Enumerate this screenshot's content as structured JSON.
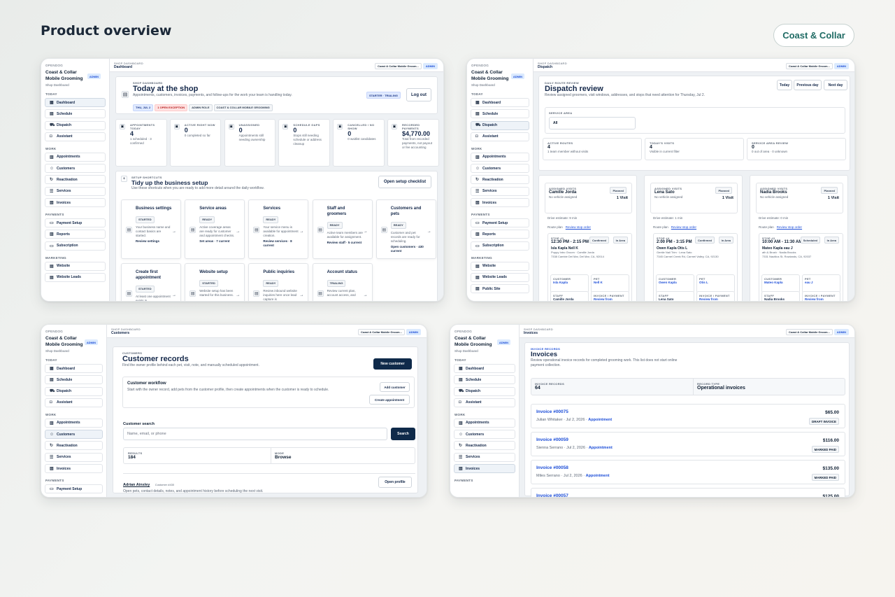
{
  "page": {
    "title": "Product overview",
    "brand": "Coast & Collar"
  },
  "sidebar": {
    "org": "OPENDOG",
    "shop": "Coast & Collar Mobile Grooming",
    "admin": "ADMIN",
    "sub": "Shop Dashboard",
    "sections": {
      "today": "TODAY",
      "work": "WORK",
      "payments": "PAYMENTS",
      "marketing": "MARKETING"
    },
    "items": {
      "dashboard": "Dashboard",
      "schedule": "Schedule",
      "dispatch": "Dispatch",
      "assistant": "Assistant",
      "appointments": "Appointments",
      "customers": "Customers",
      "reactivation": "Reactivation",
      "services": "Services",
      "invoices": "Invoices",
      "payment_setup": "Payment Setup",
      "reports": "Reports",
      "subscription": "Subscription",
      "website": "Website",
      "website_leads": "Website Leads",
      "public_site": "Public Site"
    }
  },
  "topbar": {
    "kicker": "SHOP DASHBOARD",
    "shop_chip": "Coast & Collar Mobile Groom...",
    "admin": "ADMIN"
  },
  "dashboard": {
    "crumb": "Dashboard",
    "kicker": "SHOP DASHBOARD",
    "title": "Today at the shop",
    "desc": "Appointments, customers, invoices, payments, and follow-ups for the work your team is handling today.",
    "tags": [
      "THU, JUL 2",
      "1 OPEN EXCEPTION",
      "ADMIN ROLE",
      "COAST & COLLAR MOBILE GROOMING"
    ],
    "plan": "STARTER · TRIALING",
    "logout": "Log out",
    "stats": [
      {
        "label": "APPOINTMENTS TODAY",
        "value": "4",
        "note": "1 scheduled · 3 confirmed"
      },
      {
        "label": "ACTIVE RIGHT NOW",
        "value": "0",
        "note": "0 completed so far"
      },
      {
        "label": "UNASSIGNED",
        "value": "0",
        "note": "Appointments still needing ownership"
      },
      {
        "label": "SCHEDULE GAPS",
        "value": "0",
        "note": "Stops still needing schedule or address cleanup"
      },
      {
        "label": "CANCELLED / NO SHOW",
        "value": "0",
        "note": "0 waitlist candidates"
      },
      {
        "label": "RECORDED PAYMENTS",
        "value": "$4,770.00",
        "note": "Total from recorded payments, not payout or fee accounting"
      }
    ],
    "setup": {
      "kicker": "SETUP SHORTCUTS",
      "title": "Tidy up the business setup",
      "desc": "Use these shortcuts when you are ready to add more detail around the daily workflow.",
      "button": "Open setup checklist"
    },
    "tiles": [
      {
        "title": "Business settings",
        "badge": "STARTED",
        "desc": "Your business name and contact basics are started.",
        "link": "Review settings"
      },
      {
        "title": "Service areas",
        "badge": "READY",
        "desc": "Active coverage areas are ready for customer and appointment checks.",
        "link": "Set areas · 7 current"
      },
      {
        "title": "Services",
        "badge": "READY",
        "desc": "Your service menu is available for appointment creation.",
        "link": "Review services · 8 current"
      },
      {
        "title": "Staff and groomers",
        "badge": "READY",
        "desc": "Active team members are available for assignment.",
        "link": "Review staff · 5 current"
      },
      {
        "title": "Customers and pets",
        "badge": "READY",
        "desc": "Customer and pet records are ready for scheduling.",
        "link": "Open customers · 430 current"
      },
      {
        "title": "Create first appointment",
        "badge": "STARTED",
        "desc": "At least one appointment exists in",
        "link": ""
      },
      {
        "title": "Website setup",
        "badge": "STARTED",
        "desc": "Website setup has been started for this business.",
        "link": ""
      },
      {
        "title": "Public inquiries",
        "badge": "READY",
        "desc": "Review inbound website inquiries here once lead capture is",
        "link": ""
      },
      {
        "title": "Account status",
        "badge": "TRIALING",
        "desc": "Review current plan, account access, and",
        "link": ""
      }
    ]
  },
  "dispatch": {
    "crumb": "Dispatch",
    "kicker": "DAILY ROUTE REVIEW",
    "title": "Dispatch review",
    "desc": "Review assigned groomers, visit windows, addresses, and stops that need attention for Thursday, Jul 2.",
    "buttons": [
      "Today",
      "Previous day",
      "Next day"
    ],
    "area_label": "SERVICE AREA",
    "area_value": "All",
    "stats": [
      {
        "label": "ACTIVE ROUTES",
        "value": "4",
        "note": "1 team member without visits"
      },
      {
        "label": "TODAY'S VISITS",
        "value": "4",
        "note": "Visible in current filter"
      },
      {
        "label": "SERVICE AREA REVIEW",
        "value": "0",
        "note": "0 out of area · 0 unknown"
      }
    ],
    "routes": [
      {
        "kicker": "ASSIGNED VISITS",
        "name": "Camille Jorda",
        "status": "Planned",
        "vehicle": "No vehicle assigned",
        "count": "1 Visit",
        "drive": "Drive estimate: 9 min",
        "plan": "Route plan",
        "review": "Review stop order",
        "stop": "STOP #1",
        "time": "12:30 PM - 2:15 PM",
        "badge1": "Confirmed",
        "badge2": "In Area",
        "pet": "Isla Kapla  Nell K",
        "svc": "Puppy Intro Groom · Camille Jorda",
        "addr": "7338 Cambie Del Mar, Del Mar, CA, 92014",
        "customer": "Isla Kapla",
        "petname": "Nell K",
        "staff": "Camille Jorda"
      },
      {
        "kicker": "ASSIGNED VISITS",
        "name": "Lena Sato",
        "status": "Planned",
        "vehicle": "No vehicle assigned",
        "count": "1 Visit",
        "drive": "Drive estimate: 1 min",
        "plan": "Route plan",
        "review": "Review stop order",
        "stop": "STOP #4",
        "time": "2:00 PM - 3:15 PM",
        "badge1": "Confirmed",
        "badge2": "In Area",
        "pet": "Owen Kapla  Otis L",
        "svc": "Gentle Nail Trim · Lena Sato",
        "addr": "7345 Carmel Creek Rd, Carmel Valley, CA, 92130",
        "customer": "Owen Kapla",
        "petname": "Otis L",
        "staff": "Lena Sato"
      },
      {
        "kicker": "ASSIGNED VISITS",
        "name": "Nadia Brooks",
        "status": "Planned",
        "vehicle": "No vehicle assigned",
        "count": "1 Visit",
        "drive": "Drive estimate: 0 min",
        "plan": "Route plan",
        "review": "Review stop order",
        "stop": "STOP #2",
        "time": "10:00 AM - 11:30 AM",
        "badge1": "Scheduled",
        "badge2": "In Area",
        "pet": "Mateo Kapla  eau J",
        "svc": "ath & Brush · Nadia Brooks",
        "addr": "7331 Nautilus St, Rowlands, CA, 92037",
        "customer": "Mateo Kapla",
        "petname": "eau J",
        "staff": "Nadia Brooks"
      }
    ],
    "labels": {
      "customer": "CUSTOMER",
      "pet": "PET",
      "staff": "STAFF",
      "invoice": "INVOICE / PAYMENT",
      "review": "Review from appointment detail"
    }
  },
  "customers": {
    "crumb": "Customers",
    "kicker": "CUSTOMERS",
    "title": "Customer records",
    "desc": "Find the owner profile behind each pet, visit, note, and manually scheduled appointment.",
    "new": "New customer",
    "workflow_title": "Customer workflow",
    "workflow_desc": "Start with the owner record, add pets from the customer profile, then create appointments when the customer is ready to schedule.",
    "add": "Add customer",
    "create": "Create appointment",
    "search_label": "Customer search",
    "search_placeholder": "Name, email, or phone",
    "search_button": "Search",
    "results_label": "RESULTS",
    "results_value": "184",
    "mode_label": "MODE",
    "mode_value": "Browse",
    "row_name": "Adrian Ainsley",
    "row_tag": "Customer #430",
    "row_desc": "Open pets, contact details, notes, and appointment history before scheduling the next visit.",
    "row_button": "Open profile"
  },
  "invoices": {
    "crumb": "Invoices",
    "kicker": "INVOICE RECORDS",
    "title": "Invoices",
    "desc": "Review operational invoice records for completed grooming work. This list does not start online payment collection.",
    "count_label": "INVOICE RECORDS",
    "count_value": "64",
    "type_label": "RECORD TYPE",
    "type_value": "Operational invoices",
    "rows": [
      {
        "no": "Invoice #00075",
        "amount": "$65.00",
        "who": "Julian Whitaker · Jul 2, 2026 · ",
        "link": "Appointment",
        "status": "DRAFT INVOICE"
      },
      {
        "no": "Invoice #00059",
        "amount": "$116.00",
        "who": "Sienna Serrano · Jul 2, 2026 · ",
        "link": "Appointment",
        "status": "MARKED PAID"
      },
      {
        "no": "Invoice #00058",
        "amount": "$135.00",
        "who": "Miles Serrano · Jul 2, 2026 · ",
        "link": "Appointment",
        "status": "MARKED PAID"
      },
      {
        "no": "Invoice #00057",
        "amount": "$125.00",
        "who": "",
        "link": "",
        "status": ""
      }
    ]
  }
}
